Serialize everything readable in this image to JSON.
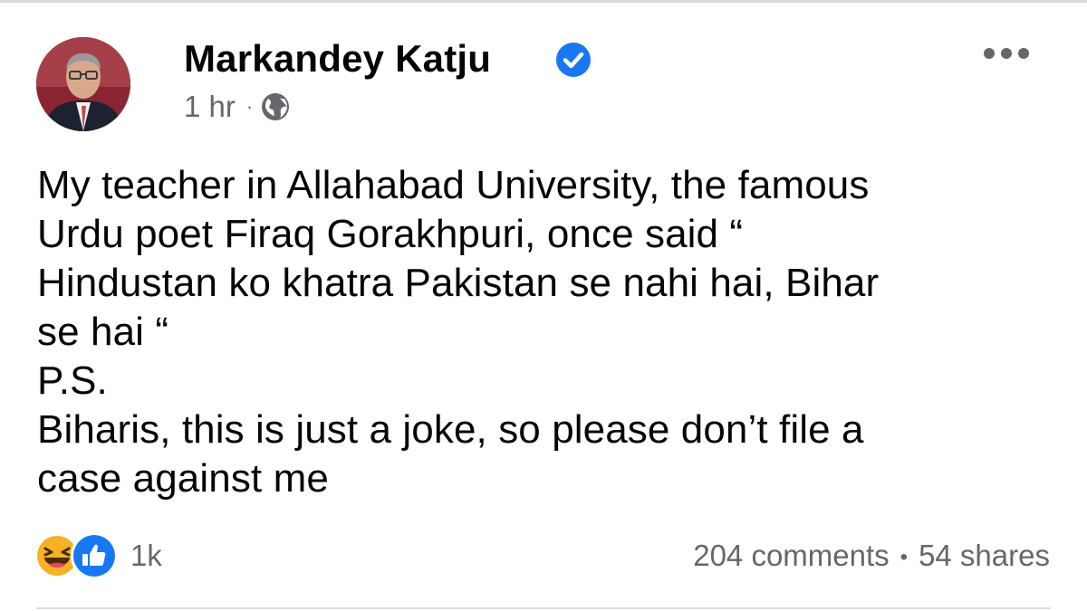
{
  "post": {
    "author": "Markandey Katju",
    "time": "1 hr",
    "separator": "·",
    "lines": [
      "My teacher in Allahabad University, the famous",
      "Urdu poet Firaq Gorakhpuri, once said “",
      "Hindustan ko khatra Pakistan se nahi hai, Bihar",
      "se hai “",
      "P.S.",
      "Biharis, this is just a joke, so please don’t file a",
      "case against me"
    ]
  },
  "footer": {
    "reaction_count": "1k",
    "comments": "204 comments",
    "separator": "•",
    "shares": "54 shares"
  },
  "icons": {
    "verified": "verified-badge-icon",
    "audience": "globe-icon",
    "more": "more-options-icon",
    "reactions": [
      "haha-reaction-icon",
      "like-reaction-icon"
    ]
  },
  "colors": {
    "verified": "#1877f2",
    "secondary_text": "#65676b",
    "primary_text": "#050505",
    "like": "#1877f2",
    "haha": "#f7b125"
  }
}
